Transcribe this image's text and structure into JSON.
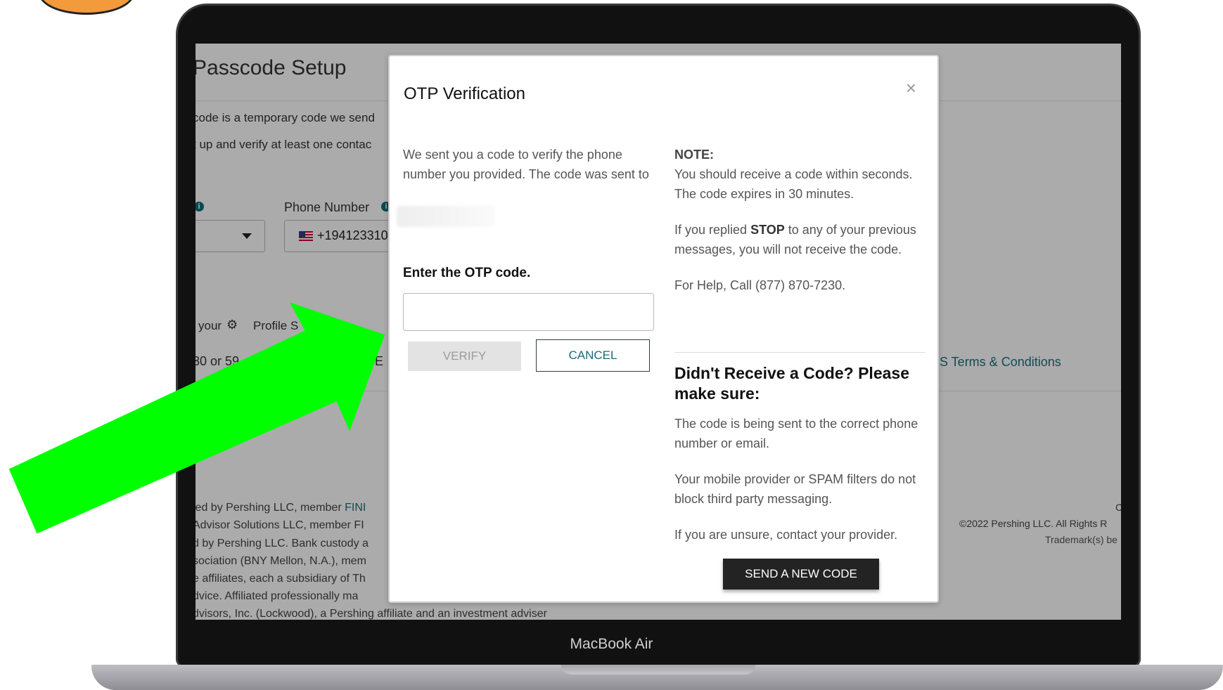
{
  "laptop": {
    "brand_label": "MacBook Air"
  },
  "background_page": {
    "title": "Passcode Setup",
    "line1": "code is a temporary code we send",
    "line2": "t up and verify at least one contac",
    "phone_label": "Phone Number",
    "phone_value": "+194123310",
    "profile_text_your": "your",
    "profile_text_profile": "Profile S",
    "timing_text": "30 or 59",
    "e_text": "E",
    "terms_link": "S Terms & Conditions",
    "footer_lines": [
      "led by Pershing LLC, member ",
      "Advisor Solutions LLC, member FI",
      "d by Pershing LLC. Bank custody a",
      "sociation (BNY Mellon, N.A.), mem",
      "e affiliates, each a subsidiary of Th",
      "dvice. Affiliated professionally ma",
      "dvisors, Inc. (Lockwood), a Pershing affiliate and an investment adviser"
    ],
    "footer_fini": "FINI",
    "copyright": "©2022 Pershing LLC. All Rights R",
    "trademark": "Trademark(s) be",
    "c_char": "C"
  },
  "modal": {
    "title": "OTP Verification",
    "close_symbol": "×",
    "sent_text": "We sent you a code to verify the phone number you provided. The code was sent to",
    "otp_label": "Enter the OTP code.",
    "otp_value": "",
    "verify_label": "VERIFY",
    "cancel_label": "CANCEL",
    "note_heading": "NOTE:",
    "note_line1": "You should receive a code within seconds.",
    "note_line2": "The code expires in 30 minutes.",
    "stop_pre": "If you replied ",
    "stop_word": "STOP",
    "stop_post": " to any of your previous messages, you will not receive the code.",
    "help_text": "For Help, Call (877) 870-7230.",
    "didnt_heading": "Didn't Receive a Code? Please make sure:",
    "tip1": "The code is being sent to the correct phone number or email.",
    "tip2": "Your mobile provider or SPAM filters do not block third party messaging.",
    "tip3": "If you are unsure, contact your provider.",
    "send_new_label": "SEND A NEW CODE"
  },
  "colors": {
    "arrow": "#00ff00",
    "accent": "#1f6f7b",
    "send_button": "#232323"
  }
}
